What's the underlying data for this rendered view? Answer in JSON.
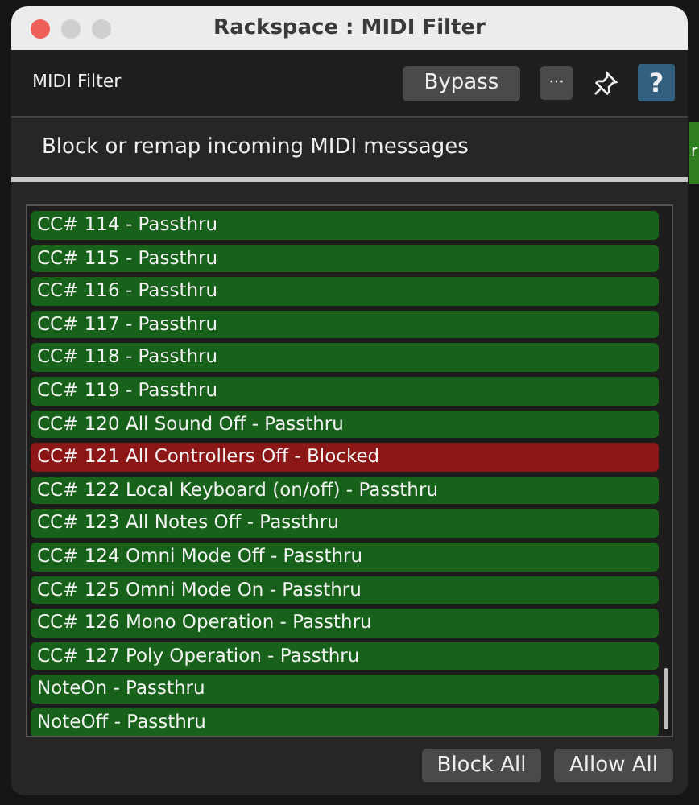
{
  "window": {
    "title": "Rackspace : MIDI Filter"
  },
  "toolbar": {
    "title": "MIDI Filter",
    "bypass_button": "Bypass",
    "more_button": "···",
    "help_button": "?"
  },
  "description": "Block or remap incoming MIDI messages",
  "background_fragment": "r",
  "messages": [
    {
      "label": "CC# 114 - Passthru",
      "blocked": false
    },
    {
      "label": "CC# 115 - Passthru",
      "blocked": false
    },
    {
      "label": "CC# 116 - Passthru",
      "blocked": false
    },
    {
      "label": "CC# 117 - Passthru",
      "blocked": false
    },
    {
      "label": "CC# 118 - Passthru",
      "blocked": false
    },
    {
      "label": "CC# 119 - Passthru",
      "blocked": false
    },
    {
      "label": "CC# 120 All Sound Off - Passthru",
      "blocked": false
    },
    {
      "label": "CC# 121 All Controllers Off - Blocked",
      "blocked": true
    },
    {
      "label": "CC# 122 Local Keyboard (on/off) - Passthru",
      "blocked": false
    },
    {
      "label": "CC# 123 All Notes Off - Passthru",
      "blocked": false
    },
    {
      "label": "CC# 124 Omni Mode Off - Passthru",
      "blocked": false
    },
    {
      "label": "CC# 125 Omni Mode On - Passthru",
      "blocked": false
    },
    {
      "label": "CC# 126 Mono Operation - Passthru",
      "blocked": false
    },
    {
      "label": "CC# 127 Poly Operation - Passthru",
      "blocked": false
    },
    {
      "label": "NoteOn - Passthru",
      "blocked": false
    },
    {
      "label": "NoteOff - Passthru",
      "blocked": false
    }
  ],
  "buttons": [
    "Block All",
    "Allow All"
  ]
}
